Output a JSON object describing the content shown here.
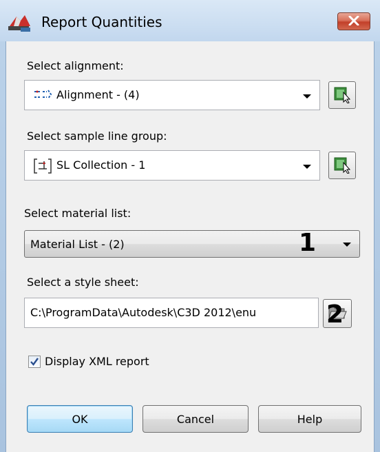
{
  "window": {
    "title": "Report Quantities"
  },
  "alignment": {
    "label": "Select alignment:",
    "value": "Alignment - (4)"
  },
  "sample_line_group": {
    "label": "Select sample line group:",
    "value": "SL Collection - 1"
  },
  "material_list": {
    "label": "Select material list:",
    "value": "Material List - (2)",
    "marker": "1"
  },
  "style_sheet": {
    "label": "Select a style sheet:",
    "value": "C:\\ProgramData\\Autodesk\\C3D 2012\\enu",
    "marker": "2"
  },
  "display_xml": {
    "label": "Display XML report",
    "checked": true
  },
  "buttons": {
    "ok": "OK",
    "cancel": "Cancel",
    "help": "Help"
  },
  "colors": {
    "title_bar": "#c2d7ee",
    "close_button": "#c2402a",
    "client_bg": "#f0f0f0",
    "default_button": "#bee6fd"
  },
  "icons": [
    "app-icon",
    "close-icon",
    "alignment-icon",
    "sample-line-icon",
    "pick-from-drawing-icon",
    "open-folder-icon",
    "checkmark-icon"
  ]
}
